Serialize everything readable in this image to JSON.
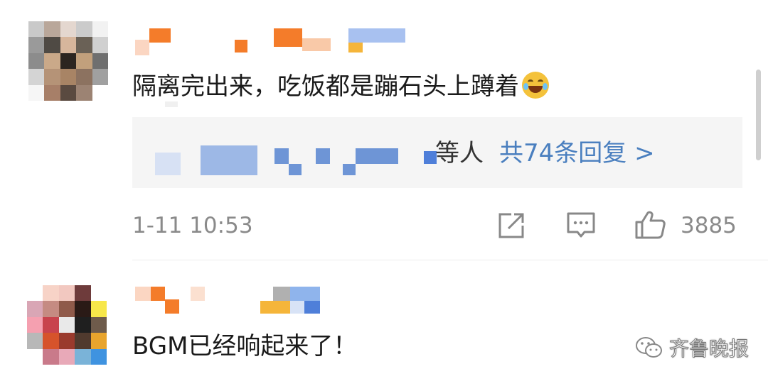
{
  "comments": [
    {
      "text": "隔离完出来，吃饭都是蹦石头上蹲着",
      "emoji": "laughing-with-tears",
      "replies": {
        "suffix": "等人",
        "link": "共74条回复 >"
      },
      "time": "1-11 10:53",
      "likes": "3885"
    },
    {
      "text": "BGM已经响起来了！"
    }
  ],
  "watermark": {
    "text": "齐鲁晚报"
  },
  "colors": {
    "link": "#4a7fbf",
    "meta": "#8a8a8a",
    "reply_bg": "#f5f5f5",
    "name_orange": "#f47c2a",
    "name_blue": "#4f7fd9"
  }
}
